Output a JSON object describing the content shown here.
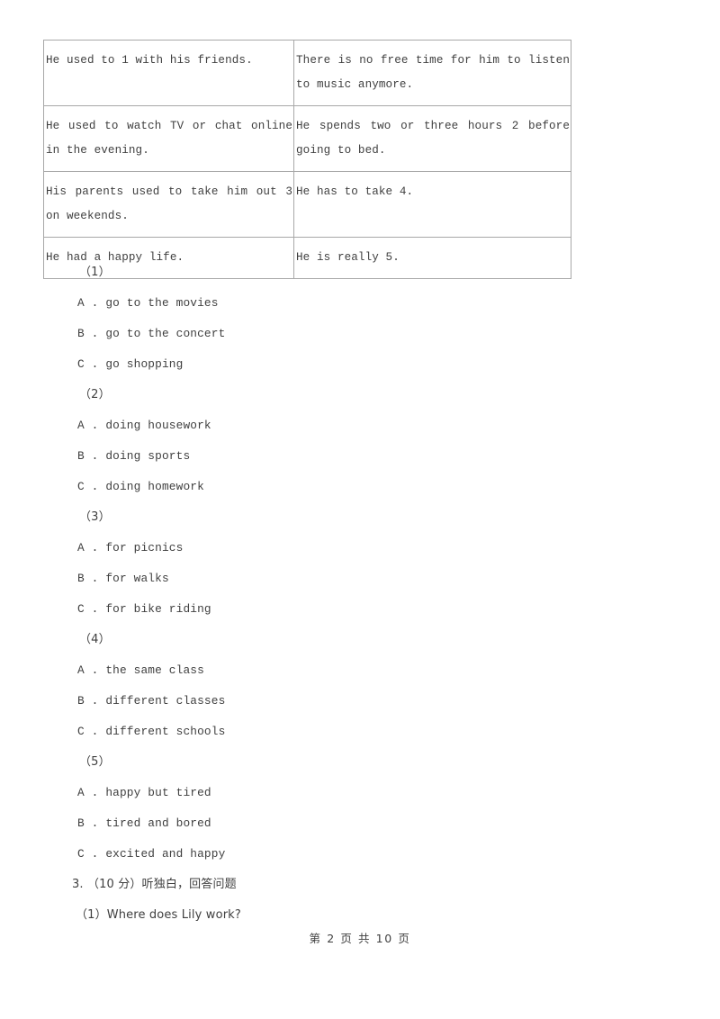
{
  "document": {
    "table": {
      "rows": [
        {
          "left": "He used to 1 with his friends.",
          "right": "There is no free time for him to listen to music anymore."
        },
        {
          "left": "He used to watch TV or chat online in the evening.",
          "right": "He spends two or three hours 2 before going to bed."
        },
        {
          "left": "His parents used to take him out 3 on weekends.",
          "right": "He has to take 4."
        },
        {
          "left": "He had a happy life.",
          "right": "He is really 5."
        }
      ]
    },
    "questions": [
      {
        "number": "（1）",
        "options": [
          "A . go to the movies",
          "B . go to the concert",
          "C . go shopping"
        ]
      },
      {
        "number": "（2）",
        "options": [
          "A . doing housework",
          "B . doing sports",
          "C . doing homework"
        ]
      },
      {
        "number": "（3）",
        "options": [
          "A . for picnics",
          "B . for walks",
          "C . for bike riding"
        ]
      },
      {
        "number": "（4）",
        "options": [
          "A . the same class",
          "B . different classes",
          "C . different schools"
        ]
      },
      {
        "number": "（5）",
        "options": [
          "A . happy but tired",
          "B . tired and bored",
          "C . excited and happy"
        ]
      }
    ],
    "next_section": {
      "heading": "3. （10 分）听独白，回答问题",
      "sub_question": "（1）Where does Lily work?"
    },
    "footer": {
      "page_label": "第 2 页 共 10 页"
    }
  }
}
